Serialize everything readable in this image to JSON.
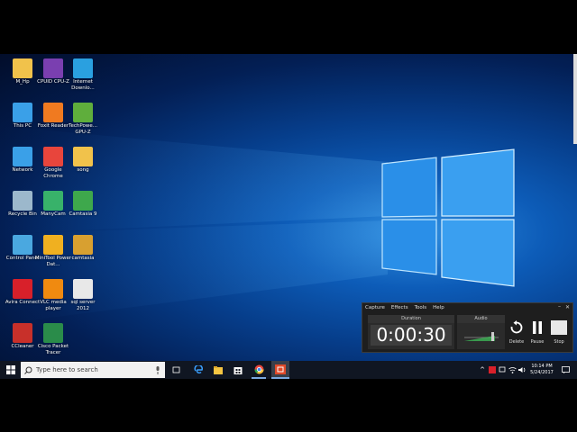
{
  "desktop": {
    "icons": [
      {
        "label": "M_Hp",
        "icon": "user-folder-icon",
        "color": "#f1c24b"
      },
      {
        "label": "CPUID CPU-Z",
        "icon": "cpuz-icon",
        "color": "#7a3fb0"
      },
      {
        "label": "Internet Downlo...",
        "icon": "idm-icon",
        "color": "#2aa0e0"
      },
      {
        "label": "This PC",
        "icon": "computer-icon",
        "color": "#3aa0e8"
      },
      {
        "label": "Foxit Reader",
        "icon": "foxit-icon",
        "color": "#f07a20"
      },
      {
        "label": "TechPowe... GPU-Z",
        "icon": "gpuz-icon",
        "color": "#5fae3c"
      },
      {
        "label": "Network",
        "icon": "network-icon",
        "color": "#3aa0e8"
      },
      {
        "label": "Google Chrome",
        "icon": "chrome-icon",
        "color": "#e8453c"
      },
      {
        "label": "song",
        "icon": "folder-icon",
        "color": "#f1c24b"
      },
      {
        "label": "Recycle Bin",
        "icon": "recycle-bin-icon",
        "color": "#9cb8cc"
      },
      {
        "label": "ManyCam",
        "icon": "manycam-icon",
        "color": "#38b26a"
      },
      {
        "label": "Camtasia 9",
        "icon": "camtasia-icon",
        "color": "#3ea84c"
      },
      {
        "label": "Control Panel",
        "icon": "control-panel-icon",
        "color": "#4aa8e0"
      },
      {
        "label": "MiniTool Power Dat...",
        "icon": "minitool-icon",
        "color": "#f0b020"
      },
      {
        "label": "camtasia",
        "icon": "package-icon",
        "color": "#d8a030"
      },
      {
        "label": "Avira Connect",
        "icon": "avira-icon",
        "color": "#d8202a"
      },
      {
        "label": "VLC media player",
        "icon": "vlc-icon",
        "color": "#f08a10"
      },
      {
        "label": "sql server 2012",
        "icon": "document-icon",
        "color": "#e8e8e8"
      },
      {
        "label": "CCleaner",
        "icon": "ccleaner-icon",
        "color": "#c8302a"
      },
      {
        "label": "Cisco Packet Tracer",
        "icon": "cisco-icon",
        "color": "#2a8c4a"
      }
    ]
  },
  "taskbar": {
    "search_placeholder": "Type here to search",
    "time": "10:14 PM",
    "date": "5/24/2017"
  },
  "recorder": {
    "menu": [
      "Capture",
      "Effects",
      "Tools",
      "Help"
    ],
    "duration_label": "Duration",
    "duration_value": "0:00:30",
    "audio_label": "Audio",
    "delete_label": "Delete",
    "pause_label": "Pause",
    "stop_label": "Stop"
  }
}
